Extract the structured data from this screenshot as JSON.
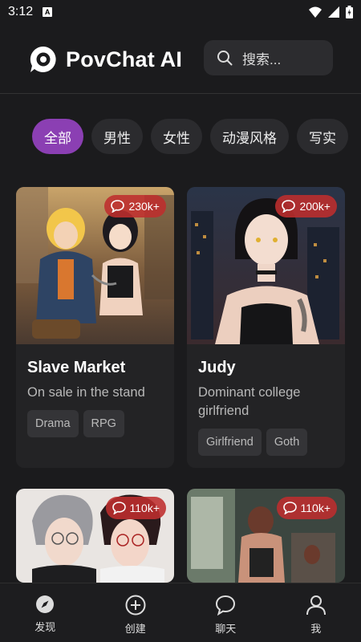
{
  "status": {
    "time": "3:12",
    "app_icon_letter": "A"
  },
  "header": {
    "app_title": "PovChat AI",
    "search_placeholder": "搜索..."
  },
  "categories": [
    "全部",
    "男性",
    "女性",
    "动漫风格",
    "写实"
  ],
  "cards": [
    {
      "title": "Slave Market",
      "description": "On sale in the stand",
      "count": "230k+",
      "tags": [
        "Drama",
        "RPG"
      ]
    },
    {
      "title": "Judy",
      "description": "Dominant college girlfriend",
      "count": "200k+",
      "tags": [
        "Girlfriend",
        "Goth"
      ]
    },
    {
      "title": "",
      "description": "",
      "count": "110k+",
      "tags": []
    },
    {
      "title": "",
      "description": "",
      "count": "110k+",
      "tags": []
    }
  ],
  "bottom_nav": [
    {
      "label": "发现",
      "icon": "compass-icon"
    },
    {
      "label": "创建",
      "icon": "plus-circle-icon"
    },
    {
      "label": "聊天",
      "icon": "chat-bubble-icon"
    },
    {
      "label": "我",
      "icon": "user-icon"
    }
  ],
  "colors": {
    "accent": "#8b3fb3",
    "badge": "#be2d2d",
    "background": "#1b1b1d"
  }
}
